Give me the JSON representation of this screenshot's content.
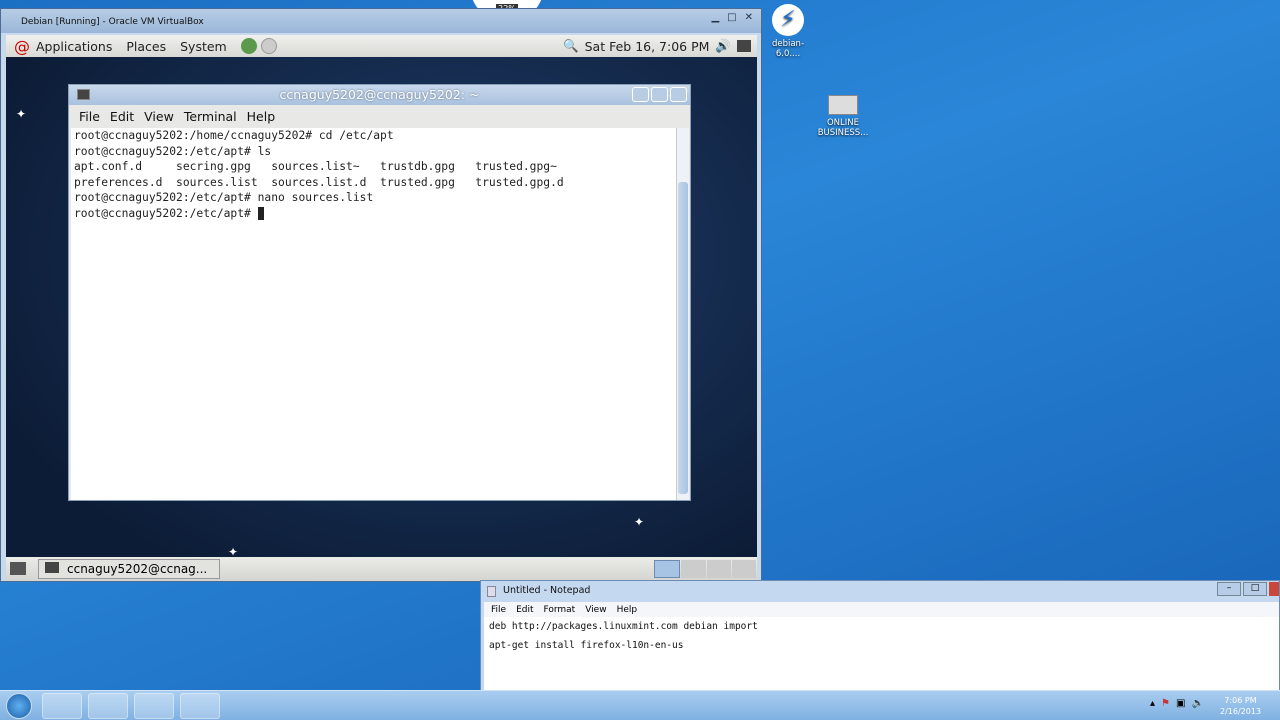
{
  "virtualbox": {
    "title": "Debian [Running] - Oracle VM VirtualBox",
    "min": "▁",
    "max": "□",
    "close": "✕"
  },
  "gnome_panel": {
    "menus": [
      "Applications",
      "Places",
      "System"
    ],
    "clock": "Sat Feb 16,  7:06 PM"
  },
  "gnome_bottom": {
    "task": "ccnaguy5202@ccnag..."
  },
  "terminal": {
    "title": "ccnaguy5202@ccnaguy5202: ~",
    "menu": [
      "File",
      "Edit",
      "View",
      "Terminal",
      "Help"
    ],
    "lines": [
      "root@ccnaguy5202:/home/ccnaguy5202# cd /etc/apt",
      "root@ccnaguy5202:/etc/apt# ls",
      "apt.conf.d     secring.gpg   sources.list~   trustdb.gpg   trusted.gpg~",
      "preferences.d  sources.list  sources.list.d  trusted.gpg   trusted.gpg.d",
      "root@ccnaguy5202:/etc/apt# nano sources.list",
      "root@ccnaguy5202:/etc/apt# "
    ]
  },
  "desktop_icons": [
    "debian-6.0....",
    "ONLINE BUSINESS..."
  ],
  "notepad": {
    "title": "Untitled - Notepad",
    "menu": [
      "File",
      "Edit",
      "Format",
      "View",
      "Help"
    ],
    "lines": [
      "deb http://packages.linuxmint.com debian import",
      "",
      "apt-get install firefox-l10n-en-us"
    ]
  },
  "tray": {
    "time": "7:06 PM",
    "date": "2/16/2013"
  },
  "zoom_badge": "22%"
}
